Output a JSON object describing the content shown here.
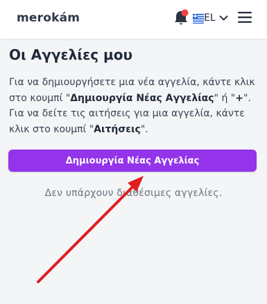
{
  "header": {
    "logo_text": "merokám",
    "language_code": "EL",
    "notification_has_badge": true,
    "icons": [
      "bell-icon",
      "greek-flag-icon",
      "chevron-down-icon",
      "hamburger-menu-icon"
    ]
  },
  "main": {
    "title": "Οι Αγγελίες μου",
    "description": {
      "part1": "Για να δημιουργήσετε μια νέα αγγελία, κάντε κλικ στο κουμπί \"",
      "bold1": "Δημιουργία Νέας Αγγελίας",
      "part2": "\" ή \"",
      "bold2": "+",
      "part3": "\". Για να δείτε τις αιτήσεις για μια αγγελία, κάντε κλικ στο κουμπί \"",
      "bold3": "Αιτήσεις",
      "part4": "\"."
    },
    "create_button_label": "Δημιουργία Νέας Αγγελίας",
    "empty_message": "Δεν υπάρχουν διαθέσιμες αγγελίες."
  },
  "colors": {
    "accent": "#9333ea",
    "annotation_arrow": "#e11d1d",
    "badge": "#ef4444",
    "page_background": "#f4f5f7"
  }
}
